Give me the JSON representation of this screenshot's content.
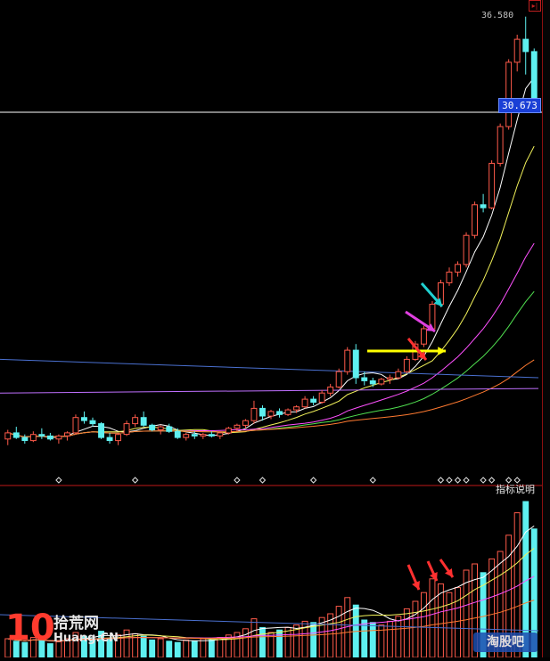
{
  "labels": {
    "price_high": "36.580",
    "price_current": "30.673",
    "indicator_help": "指标说明",
    "menu_glyph": "▸|"
  },
  "watermarks": {
    "left_number": "10",
    "left_cn": "拾荒网",
    "left_en": "Huang.CN",
    "right": "淘股吧"
  },
  "colors": {
    "up_candle": "#ff5a4a",
    "down_candle": "#5ef0f0",
    "ma1": "#ffffff",
    "ma2": "#f2f25a",
    "ma3": "#ff50ff",
    "ma4": "#50e050",
    "ma5": "#ff7a30",
    "ma6": "#c070ff",
    "ma7": "#4a70d0",
    "grid_red": "#c01818",
    "price_line": "#ffffff",
    "arrow_yellow": "#ffff00",
    "arrow_red": "#ff3030",
    "arrow_magenta": "#e040e0",
    "arrow_cyan": "#20d0d0"
  },
  "chart_data": {
    "type": "candlestick",
    "title": "",
    "y_reference_current": 30.673,
    "y_visible_high": 36.58,
    "candles": [
      [
        9.0,
        9.6,
        8.6,
        9.4
      ],
      [
        9.4,
        9.8,
        9.0,
        9.1
      ],
      [
        9.1,
        9.3,
        8.7,
        8.9
      ],
      [
        8.9,
        9.5,
        8.8,
        9.3
      ],
      [
        9.3,
        9.7,
        9.0,
        9.2
      ],
      [
        9.2,
        9.4,
        8.9,
        9.0
      ],
      [
        9.0,
        9.3,
        8.7,
        9.2
      ],
      [
        9.2,
        9.5,
        8.9,
        9.4
      ],
      [
        9.4,
        10.6,
        9.3,
        10.4
      ],
      [
        10.4,
        10.8,
        10.0,
        10.2
      ],
      [
        10.2,
        10.4,
        9.8,
        10.0
      ],
      [
        10.0,
        10.1,
        9.0,
        9.1
      ],
      [
        9.1,
        9.4,
        8.7,
        8.9
      ],
      [
        8.9,
        9.4,
        8.6,
        9.3
      ],
      [
        9.3,
        10.2,
        9.2,
        10.0
      ],
      [
        10.0,
        10.6,
        9.8,
        10.4
      ],
      [
        10.4,
        10.8,
        9.8,
        9.9
      ],
      [
        9.9,
        10.0,
        9.5,
        9.6
      ],
      [
        9.6,
        9.9,
        9.3,
        9.8
      ],
      [
        9.8,
        10.0,
        9.4,
        9.5
      ],
      [
        9.5,
        9.7,
        9.0,
        9.1
      ],
      [
        9.1,
        9.4,
        8.9,
        9.3
      ],
      [
        9.3,
        9.5,
        9.0,
        9.2
      ],
      [
        9.2,
        9.4,
        9.0,
        9.3
      ],
      [
        9.3,
        9.5,
        9.1,
        9.2
      ],
      [
        9.2,
        9.5,
        9.0,
        9.4
      ],
      [
        9.4,
        9.8,
        9.3,
        9.7
      ],
      [
        9.7,
        10.0,
        9.5,
        9.9
      ],
      [
        9.9,
        10.3,
        9.7,
        10.2
      ],
      [
        10.2,
        11.5,
        10.0,
        11.0
      ],
      [
        11.0,
        11.2,
        10.2,
        10.5
      ],
      [
        10.5,
        10.9,
        10.3,
        10.8
      ],
      [
        10.8,
        11.0,
        10.4,
        10.6
      ],
      [
        10.6,
        11.0,
        10.5,
        10.9
      ],
      [
        10.9,
        11.2,
        10.7,
        11.1
      ],
      [
        11.1,
        11.8,
        11.0,
        11.6
      ],
      [
        11.6,
        11.8,
        11.2,
        11.4
      ],
      [
        11.4,
        12.2,
        11.3,
        12.0
      ],
      [
        12.0,
        12.6,
        11.8,
        12.4
      ],
      [
        12.4,
        13.6,
        12.3,
        13.4
      ],
      [
        13.4,
        15.0,
        13.2,
        14.8
      ],
      [
        14.8,
        15.2,
        12.6,
        13.0
      ],
      [
        13.0,
        13.4,
        12.5,
        12.8
      ],
      [
        12.8,
        13.0,
        12.4,
        12.6
      ],
      [
        12.6,
        13.0,
        12.5,
        12.9
      ],
      [
        12.9,
        13.2,
        12.6,
        13.0
      ],
      [
        13.0,
        13.6,
        12.9,
        13.4
      ],
      [
        13.4,
        14.4,
        13.3,
        14.2
      ],
      [
        14.2,
        15.4,
        14.1,
        15.2
      ],
      [
        15.2,
        16.4,
        15.0,
        16.2
      ],
      [
        16.2,
        18.0,
        16.1,
        17.8
      ],
      [
        17.8,
        19.4,
        17.6,
        19.2
      ],
      [
        19.2,
        20.2,
        19.0,
        19.9
      ],
      [
        19.9,
        20.6,
        19.6,
        20.4
      ],
      [
        20.4,
        22.5,
        20.2,
        22.3
      ],
      [
        22.3,
        24.5,
        22.1,
        24.3
      ],
      [
        24.3,
        25.0,
        23.8,
        24.1
      ],
      [
        24.1,
        27.2,
        24.0,
        27.0
      ],
      [
        27.0,
        29.6,
        26.8,
        29.4
      ],
      [
        29.4,
        33.8,
        29.2,
        33.6
      ],
      [
        33.6,
        35.4,
        33.0,
        35.1
      ],
      [
        35.1,
        36.58,
        32.8,
        34.3
      ],
      [
        34.3,
        34.5,
        30.4,
        30.673
      ]
    ],
    "volumes": [
      30,
      26,
      24,
      32,
      28,
      22,
      25,
      30,
      40,
      34,
      30,
      42,
      30,
      36,
      44,
      38,
      34,
      28,
      30,
      26,
      24,
      28,
      26,
      30,
      28,
      32,
      36,
      40,
      46,
      62,
      48,
      40,
      44,
      48,
      52,
      58,
      56,
      64,
      70,
      82,
      96,
      84,
      60,
      56,
      52,
      58,
      66,
      78,
      90,
      104,
      126,
      118,
      104,
      112,
      140,
      150,
      136,
      158,
      170,
      196,
      232,
      250,
      206
    ]
  }
}
